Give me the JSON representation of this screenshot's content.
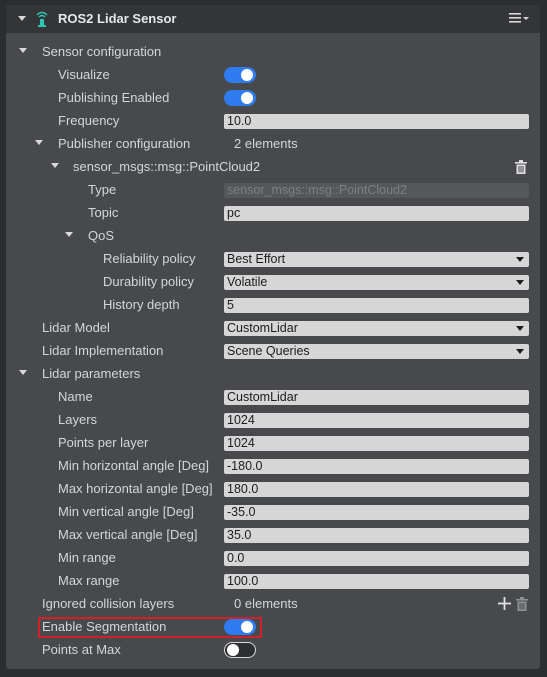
{
  "header": {
    "title": "ROS2 Lidar Sensor"
  },
  "sensor_config": {
    "title": "Sensor configuration",
    "visualize": {
      "label": "Visualize",
      "on": true
    },
    "publishing": {
      "label": "Publishing Enabled",
      "on": true
    },
    "frequency": {
      "label": "Frequency",
      "value": "10.0"
    },
    "publisher": {
      "label": "Publisher configuration",
      "count": "2 elements",
      "item": {
        "title": "sensor_msgs::msg::PointCloud2",
        "type": {
          "label": "Type",
          "value": "sensor_msgs::msg::PointCloud2"
        },
        "topic": {
          "label": "Topic",
          "value": "pc"
        },
        "qos": {
          "label": "QoS",
          "reliability": {
            "label": "Reliability policy",
            "value": "Best Effort"
          },
          "durability": {
            "label": "Durability policy",
            "value": "Volatile"
          },
          "history": {
            "label": "History depth",
            "value": "5"
          }
        }
      }
    },
    "lidar_model": {
      "label": "Lidar Model",
      "value": "CustomLidar"
    },
    "lidar_impl": {
      "label": "Lidar Implementation",
      "value": "Scene Queries"
    },
    "params": {
      "title": "Lidar parameters",
      "name": {
        "label": "Name",
        "value": "CustomLidar"
      },
      "layers": {
        "label": "Layers",
        "value": "1024"
      },
      "points": {
        "label": "Points per layer",
        "value": "1024"
      },
      "min_h": {
        "label": "Min horizontal angle [Deg]",
        "value": "-180.0"
      },
      "max_h": {
        "label": "Max horizontal angle [Deg]",
        "value": "180.0"
      },
      "min_v": {
        "label": "Min vertical angle [Deg]",
        "value": "-35.0"
      },
      "max_v": {
        "label": "Max vertical angle [Deg]",
        "value": "35.0"
      },
      "min_range": {
        "label": "Min range",
        "value": "0.0"
      },
      "max_range": {
        "label": "Max range",
        "value": "100.0"
      }
    },
    "ignored": {
      "label": "Ignored collision layers",
      "count": "0 elements"
    },
    "segmentation": {
      "label": "Enable Segmentation",
      "on": true
    },
    "points_max": {
      "label": "Points at Max",
      "on": false
    }
  },
  "colors": {
    "accent": "#2f7cf0",
    "highlight": "#d0212b",
    "panel": "#47494c"
  }
}
